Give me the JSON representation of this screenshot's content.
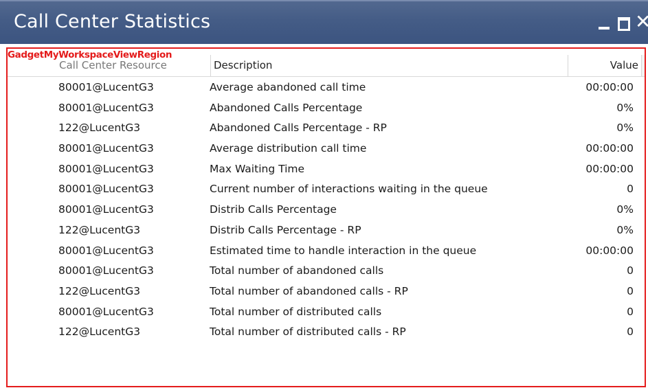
{
  "window": {
    "title": "Call Center Statistics",
    "controls": {
      "minimize": "minimize",
      "maximize": "maximize",
      "close": "✕"
    }
  },
  "region_label": "GadgetMyWorkspaceViewRegion",
  "table": {
    "columns": [
      "Call Center Resource",
      "Description",
      "Value"
    ],
    "rows": [
      {
        "resource": "80001@LucentG3",
        "description": "Average abandoned call time",
        "value": "00:00:00"
      },
      {
        "resource": "80001@LucentG3",
        "description": "Abandoned Calls Percentage",
        "value": "0%"
      },
      {
        "resource": "122@LucentG3",
        "description": "Abandoned Calls Percentage - RP",
        "value": "0%"
      },
      {
        "resource": "80001@LucentG3",
        "description": "Average distribution call time",
        "value": "00:00:00"
      },
      {
        "resource": "80001@LucentG3",
        "description": "Max Waiting Time",
        "value": "00:00:00"
      },
      {
        "resource": "80001@LucentG3",
        "description": "Current number of interactions waiting in the queue",
        "value": "0"
      },
      {
        "resource": "80001@LucentG3",
        "description": "Distrib Calls Percentage",
        "value": "0%"
      },
      {
        "resource": "122@LucentG3",
        "description": "Distrib Calls Percentage - RP",
        "value": "0%"
      },
      {
        "resource": "80001@LucentG3",
        "description": "Estimated time to handle interaction in the queue",
        "value": "00:00:00"
      },
      {
        "resource": "80001@LucentG3",
        "description": "Total number of abandoned calls",
        "value": "0"
      },
      {
        "resource": "122@LucentG3",
        "description": "Total number of abandoned calls - RP",
        "value": "0"
      },
      {
        "resource": "80001@LucentG3",
        "description": "Total number of distributed calls",
        "value": "0"
      },
      {
        "resource": "122@LucentG3",
        "description": "Total number of distributed calls - RP",
        "value": "0"
      }
    ]
  },
  "colors": {
    "titlebar": "#445c86",
    "region_outline": "#e41b1b",
    "background": "#ffffff"
  }
}
